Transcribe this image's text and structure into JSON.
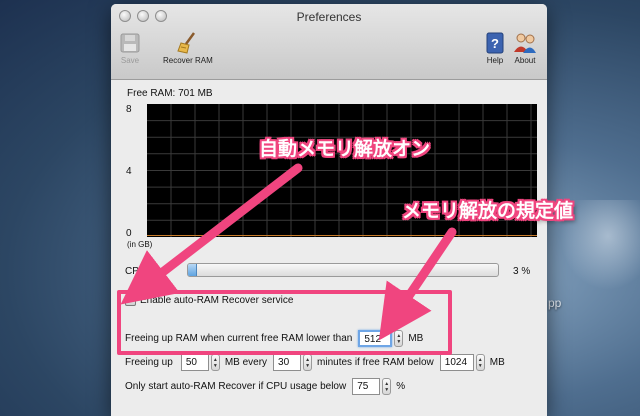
{
  "window": {
    "title": "Preferences"
  },
  "toolbar": {
    "save_label": "Save",
    "recover_label": "Recover RAM",
    "help_label": "Help",
    "about_label": "About"
  },
  "memory": {
    "free_ram_label": "Free RAM: 701 MB",
    "y_ticks": [
      "8",
      "4",
      "0"
    ],
    "unit_label": "(in GB)"
  },
  "cpu": {
    "label": "CPU",
    "value_label": "3 %",
    "fraction": 0.03
  },
  "settings": {
    "enable_label": "Enable auto-RAM Recover service",
    "enable_checked": "✔",
    "threshold_prefix": "Freeing up RAM when current free RAM lower than",
    "threshold_value": "512",
    "threshold_unit": "MB",
    "free_prefix": "Freeing up",
    "free_value": "50",
    "every_label": "MB every",
    "minutes_value": "30",
    "minutes_label": "minutes if free RAM below",
    "below_value": "1024",
    "below_unit": "MB",
    "cpu_prefix": "Only start auto-RAM Recover if CPU usage below",
    "cpu_value": "75",
    "cpu_unit": "%"
  },
  "annotations": {
    "auto_on": "自動メモリ解放オン",
    "threshold": "メモリ解放の規定値",
    "color": "#f0457f"
  },
  "desktop": {
    "fragment": "pp"
  }
}
